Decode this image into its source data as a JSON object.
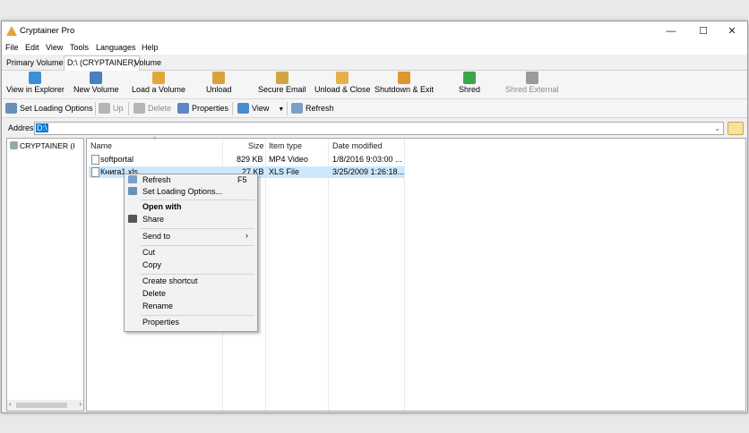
{
  "window": {
    "title": "Cryptainer Pro",
    "minimize": "—",
    "maximize": "☐",
    "close": "✕"
  },
  "menu": [
    "File",
    "Edit",
    "View",
    "Tools",
    "Languages",
    "Help"
  ],
  "tabs": [
    "Primary Volume",
    "D:\\ (CRYPTAINER)",
    "Volume"
  ],
  "toolbar1": [
    {
      "label": "View in Explorer",
      "icon": "explorer-icon",
      "color": "#3b8fd6"
    },
    {
      "label": "New Volume",
      "icon": "new-volume-icon",
      "color": "#4a7fc0"
    },
    {
      "label": "Load a Volume",
      "icon": "load-volume-icon",
      "color": "#e0a838"
    },
    {
      "label": "Unload",
      "icon": "unload-icon",
      "color": "#d7a23c"
    },
    {
      "label": "Secure Email",
      "icon": "email-icon",
      "color": "#d2a53e"
    },
    {
      "label": "Unload & Close",
      "icon": "unload-close-icon",
      "color": "#e6b04a"
    },
    {
      "label": "Shutdown & Exit",
      "icon": "shutdown-icon",
      "color": "#e0952e"
    },
    {
      "label": "Shred",
      "icon": "shred-icon",
      "color": "#3aa64c"
    },
    {
      "label": "Shred External",
      "icon": "shred-external-icon",
      "color": "#9a9a9a"
    }
  ],
  "toolbar2": [
    {
      "label": "Set Loading Options",
      "icon": "loading-options-icon"
    },
    {
      "label": "Up",
      "icon": "up-icon"
    },
    {
      "label": "Delete",
      "icon": "delete-icon"
    },
    {
      "label": "Properties",
      "icon": "properties-icon"
    },
    {
      "label": "View",
      "icon": "view-icon"
    },
    {
      "label": "Refresh",
      "icon": "refresh-icon"
    }
  ],
  "address": {
    "label": "Addres",
    "value": "D:\\"
  },
  "tree": {
    "item": "CRYPTAINER (I"
  },
  "list": {
    "columns": [
      "Name",
      "Size",
      "Item type",
      "Date modified"
    ],
    "rows": [
      {
        "name": "softportal",
        "size": "829 KB",
        "type": "MP4 Video",
        "date": "1/8/2016 9:03:00 ..."
      },
      {
        "name": "Книга1.xls",
        "size": "27 KB",
        "type": "XLS File",
        "date": "3/25/2009 1:26:18..."
      }
    ]
  },
  "context_menu": {
    "refresh": "Refresh",
    "refresh_shortcut": "F5",
    "set_loading": "Set Loading Options...",
    "open_with": "Open with",
    "share": "Share",
    "send_to": "Send to",
    "cut": "Cut",
    "copy": "Copy",
    "create_shortcut": "Create shortcut",
    "delete": "Delete",
    "rename": "Rename",
    "properties": "Properties"
  }
}
